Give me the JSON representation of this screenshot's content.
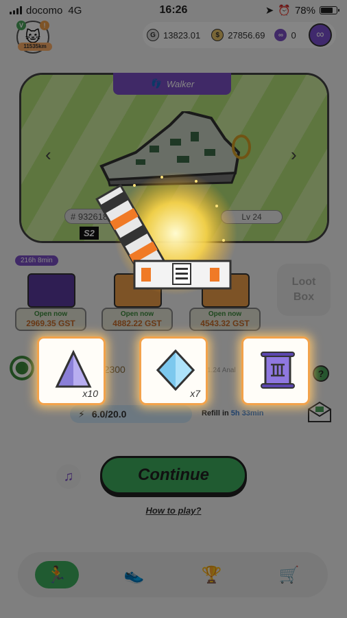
{
  "status_bar": {
    "carrier": "docomo",
    "network": "4G",
    "time": "16:26",
    "battery": "78%",
    "battery_level": 0.78
  },
  "profile": {
    "distance": "11535km",
    "badge_left": "V",
    "badge_right": "!"
  },
  "balances": {
    "gst": "13823.01",
    "gmt": "27856.69",
    "chain_count": "0"
  },
  "sneaker": {
    "class_label": "Walker",
    "id_partial": "# 93261806",
    "level": "Lv 24",
    "season": "S2"
  },
  "mystery_boxes": [
    {
      "timer": "216h 8min",
      "open_label": "Open now",
      "cost": "2969.35 GST"
    },
    {
      "timer": "",
      "open_label": "Open now",
      "cost": "4882.22 GST"
    },
    {
      "timer": "",
      "open_label": "Open now",
      "cost": "4543.32 GST"
    }
  ],
  "loot_box": {
    "label_line1": "Loot",
    "label_line2": "Box"
  },
  "stats": {
    "durability": "0/2300",
    "analysis": "1.24 Anal",
    "energy": "6.0/20.0",
    "refill_label": "Refill in",
    "refill_time": "5h 33min"
  },
  "rewards": [
    {
      "icon": "pyramid-gem-icon",
      "quantity": "x10"
    },
    {
      "icon": "crystal-gem-icon",
      "quantity": "x7"
    },
    {
      "icon": "scroll-icon",
      "quantity": ""
    }
  ],
  "continue_label": "Continue",
  "how_to_play": "How to play?",
  "tabbar": {
    "items": [
      "run",
      "sneakers",
      "ranking",
      "shop"
    ],
    "active": "run"
  },
  "colors": {
    "accent_green": "#3fae5f",
    "accent_purple": "#7c4fc6",
    "reward_border": "#f2a24b"
  }
}
